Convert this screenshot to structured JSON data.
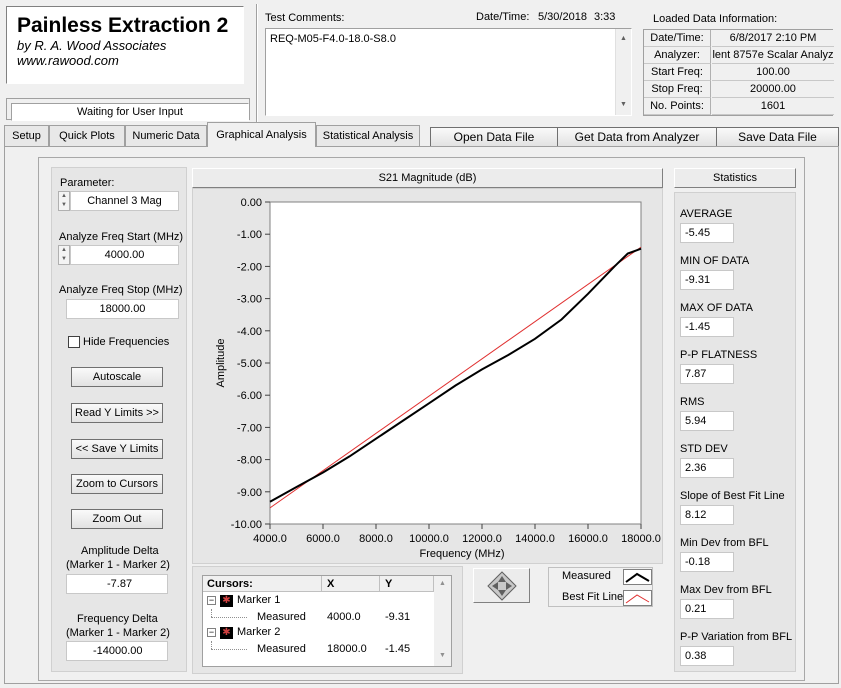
{
  "app": {
    "title": "Painless Extraction 2",
    "byline": "by R. A. Wood Associates",
    "website": "www.rawood.com",
    "status": "Waiting for User Input"
  },
  "comments": {
    "label": "Test Comments:",
    "text": "REQ-M05-F4.0-18.0-S8.0",
    "datetime_label": "Date/Time:",
    "date": "5/30/2018",
    "time": "3:33"
  },
  "loaded_info": {
    "title": "Loaded Data Information:",
    "rows": [
      {
        "key": "Date/Time:",
        "value": "6/8/2017 2:10 PM"
      },
      {
        "key": "Analyzer:",
        "value": "lent 8757e Scalar Analyz"
      },
      {
        "key": "Start Freq:",
        "value": "100.00"
      },
      {
        "key": "Stop Freq:",
        "value": "20000.00"
      },
      {
        "key": "No. Points:",
        "value": "1601"
      }
    ]
  },
  "tabs": [
    "Setup",
    "Quick Plots",
    "Numeric Data",
    "Graphical Analysis",
    "Statistical Analysis"
  ],
  "active_tab": "Graphical Analysis",
  "toolbar": {
    "open": "Open Data File",
    "get": "Get Data from Analyzer",
    "save": "Save Data File"
  },
  "left_panel": {
    "parameter_label": "Parameter:",
    "parameter_value": "Channel 3 Mag",
    "start_label": "Analyze Freq Start (MHz)",
    "start_value": "4000.00",
    "stop_label": "Analyze Freq Stop (MHz)",
    "stop_value": "18000.00",
    "hide_freq_label": "Hide Frequencies",
    "autoscale": "Autoscale",
    "read_limits": "Read Y Limits >>",
    "save_limits": "<< Save Y Limits",
    "zoom_cursors": "Zoom to Cursors",
    "zoom_out": "Zoom Out",
    "amp_delta_label1": "Amplitude Delta",
    "amp_delta_label2": "(Marker 1 - Marker 2)",
    "amp_delta_value": "-7.87",
    "freq_delta_label1": "Frequency Delta",
    "freq_delta_label2": "(Marker 1 - Marker 2)",
    "freq_delta_value": "-14000.00"
  },
  "chart_data": {
    "type": "line",
    "title": "S21 Magnitude (dB)",
    "xlabel": "Frequency (MHz)",
    "ylabel": "Amplitude",
    "xlim": [
      4000,
      18000
    ],
    "ylim": [
      -10,
      0
    ],
    "x_ticks": [
      "4000.0",
      "6000.0",
      "8000.0",
      "10000.0",
      "12000.0",
      "14000.0",
      "16000.0",
      "18000.0"
    ],
    "y_ticks": [
      "0.00",
      "-1.00",
      "-2.00",
      "-3.00",
      "-4.00",
      "-5.00",
      "-6.00",
      "-7.00",
      "-8.00",
      "-9.00",
      "-10.00"
    ],
    "grid": false,
    "series": [
      {
        "name": "Measured",
        "color": "#000000",
        "x": [
          4000,
          5000,
          6000,
          7000,
          8000,
          9000,
          10000,
          11000,
          12000,
          13000,
          14000,
          15000,
          16000,
          17000,
          17500,
          18000
        ],
        "y": [
          -9.31,
          -8.85,
          -8.4,
          -7.9,
          -7.35,
          -6.8,
          -6.25,
          -5.7,
          -5.2,
          -4.75,
          -4.25,
          -3.65,
          -2.85,
          -2.0,
          -1.6,
          -1.45
        ]
      },
      {
        "name": "Best Fit Line",
        "color": "#e03030",
        "x": [
          4000,
          18000
        ],
        "y": [
          -9.5,
          -1.4
        ]
      }
    ]
  },
  "cursors": {
    "headers": [
      "Cursors:",
      "X",
      "Y"
    ],
    "markers": [
      {
        "name": "Marker 1",
        "sub": "Measured",
        "x": "4000.0",
        "y": "-9.31"
      },
      {
        "name": "Marker 2",
        "sub": "Measured",
        "x": "18000.0",
        "y": "-1.45"
      }
    ]
  },
  "legend": {
    "measured": "Measured",
    "best_fit": "Best Fit Line"
  },
  "statistics": {
    "title": "Statistics",
    "items": [
      {
        "label": "AVERAGE",
        "value": "-5.45"
      },
      {
        "label": "MIN OF DATA",
        "value": "-9.31"
      },
      {
        "label": "MAX OF DATA",
        "value": "-1.45"
      },
      {
        "label": "P-P FLATNESS",
        "value": "7.87"
      },
      {
        "label": "RMS",
        "value": "5.94"
      },
      {
        "label": "STD DEV",
        "value": "2.36"
      },
      {
        "label": "Slope of Best Fit Line",
        "value": "8.12"
      },
      {
        "label": "Min Dev from BFL",
        "value": "-0.18"
      },
      {
        "label": "Max Dev from BFL",
        "value": "0.21"
      },
      {
        "label": "P-P Variation from BFL",
        "value": "0.38"
      }
    ]
  }
}
